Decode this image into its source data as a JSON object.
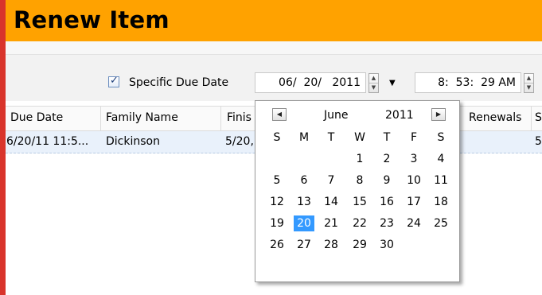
{
  "header": {
    "title": "Renew Item"
  },
  "due_date_control": {
    "checkbox_label": "Specific Due Date",
    "checked": true,
    "date_value": "06/  20/   2011",
    "time_value": "8:  53:  29 AM"
  },
  "grid": {
    "columns": [
      "Due Date",
      "Family Name",
      "Finis",
      "Renewals",
      "S"
    ],
    "rows": [
      {
        "due_date": "6/20/11 11:5...",
        "family_name": "Dickinson",
        "finish": "5/20,",
        "extra": "5"
      }
    ]
  },
  "calendar": {
    "month": "June",
    "year": "2011",
    "prev_icon": "triangle-left",
    "next_icon": "triangle-right",
    "day_headers": [
      "S",
      "M",
      "T",
      "W",
      "T",
      "F",
      "S"
    ],
    "weeks": [
      [
        "",
        "",
        "",
        "1",
        "2",
        "3",
        "4"
      ],
      [
        "5",
        "6",
        "7",
        "8",
        "9",
        "10",
        "11"
      ],
      [
        "12",
        "13",
        "14",
        "15",
        "16",
        "17",
        "18"
      ],
      [
        "19",
        "20",
        "21",
        "22",
        "23",
        "24",
        "25"
      ],
      [
        "26",
        "27",
        "28",
        "29",
        "30",
        "",
        ""
      ]
    ],
    "selected_day": "20"
  },
  "colors": {
    "header_bg": "#ffa200",
    "selected_day_bg": "#3399ff",
    "row_bg": "#e9f1fb"
  }
}
